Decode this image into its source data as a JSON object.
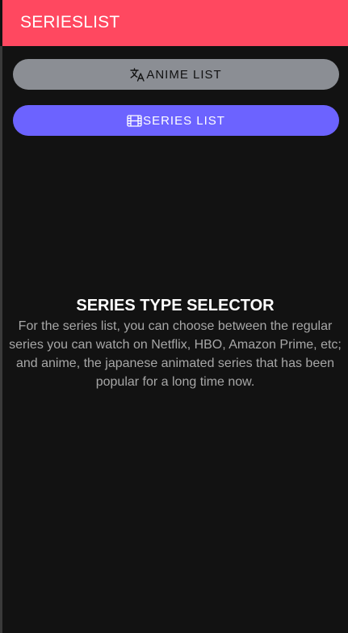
{
  "header": {
    "title": "SERIESLIST"
  },
  "buttons": {
    "anime": {
      "label": "ANIME LIST",
      "icon": "translate-icon"
    },
    "series": {
      "label": "SERIES LIST",
      "icon": "film-icon"
    }
  },
  "info": {
    "title": "SERIES TYPE SELECTOR",
    "text": "For the series list, you can choose between the regular series you can watch on Netflix, HBO, Amazon Prime, etc; and anime, the japanese animated series that has been popular for a long time now."
  },
  "colors": {
    "header": "#ff4860",
    "background": "#121212",
    "anime_button": "#8b8e94",
    "series_button": "#6c63ff",
    "body_text": "#a7a7a7"
  }
}
